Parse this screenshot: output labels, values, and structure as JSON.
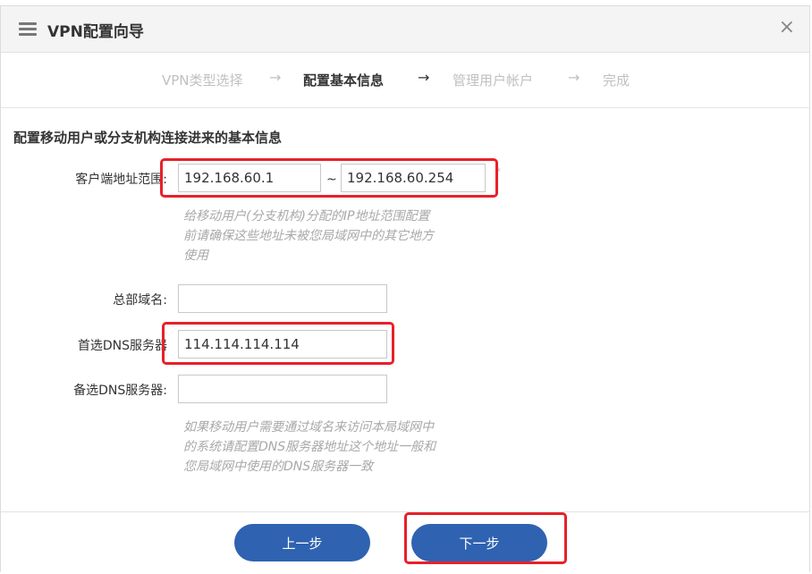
{
  "dialog": {
    "title": "VPN配置向导",
    "close_glyph": "×"
  },
  "steps": {
    "items": [
      "VPN类型选择",
      "配置基本信息",
      "管理用户帐户",
      "完成"
    ],
    "arrow": "→",
    "active_index": 1
  },
  "form": {
    "heading": "配置移动用户或分支机构连接进来的基本信息",
    "client_range": {
      "label": "客户端地址范围:",
      "start_value": "192.168.60.1",
      "separator": "~",
      "end_value": "192.168.60.254",
      "required_mark": "*",
      "hint": "给移动用户(分支机构)分配的IP地址范围配置\n前请确保这些地址未被您局域网中的其它地方\n使用"
    },
    "domain": {
      "label": "总部域名:",
      "value": ""
    },
    "primary_dns": {
      "label": "首选DNS服务器",
      "value": "114.114.114.114"
    },
    "secondary_dns": {
      "label": "备选DNS服务器:",
      "value": "",
      "hint": "如果移动用户需要通过域名来访问本局域网中\n的系统请配置DNS服务器地址这个地址一般和\n您局域网中使用的DNS服务器一致"
    }
  },
  "footer": {
    "prev_label": "上一步",
    "next_label": "下一步"
  },
  "colors": {
    "accent": "#2f62b1",
    "highlight": "#e8202a",
    "muted": "#c0c0c0"
  }
}
